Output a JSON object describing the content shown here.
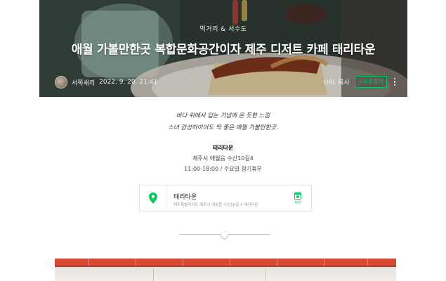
{
  "hero": {
    "category": "먹거리 & 서수도",
    "title": "애월 가볼만한곳 복합문화공간이자 제주 디저트 카페 태리타운",
    "author": "서쪽새리",
    "date": "2022. 9. 20. 21:41",
    "url_copy": "URL 복사",
    "neighbor_button": "+이웃추가"
  },
  "body": {
    "intro_line1": "바다 위에서 입는 기념에 온 듯한 느낌",
    "intro_line2": "소녀 감성하이어도 딱 좋은 애월 가볼만한곳.",
    "place_name": "태리타운",
    "address": "제주시 애월읍 수산10길4",
    "hours": "11:00-18:00 / 수요일 정기휴무"
  },
  "map_card": {
    "name": "태리타운",
    "address": "제주특별자치도 제주시 애월읍 수산10길 4 태리타운",
    "route_label": "위치"
  },
  "colors": {
    "accent": "#03c75a",
    "photo_band": "#d64a36"
  }
}
